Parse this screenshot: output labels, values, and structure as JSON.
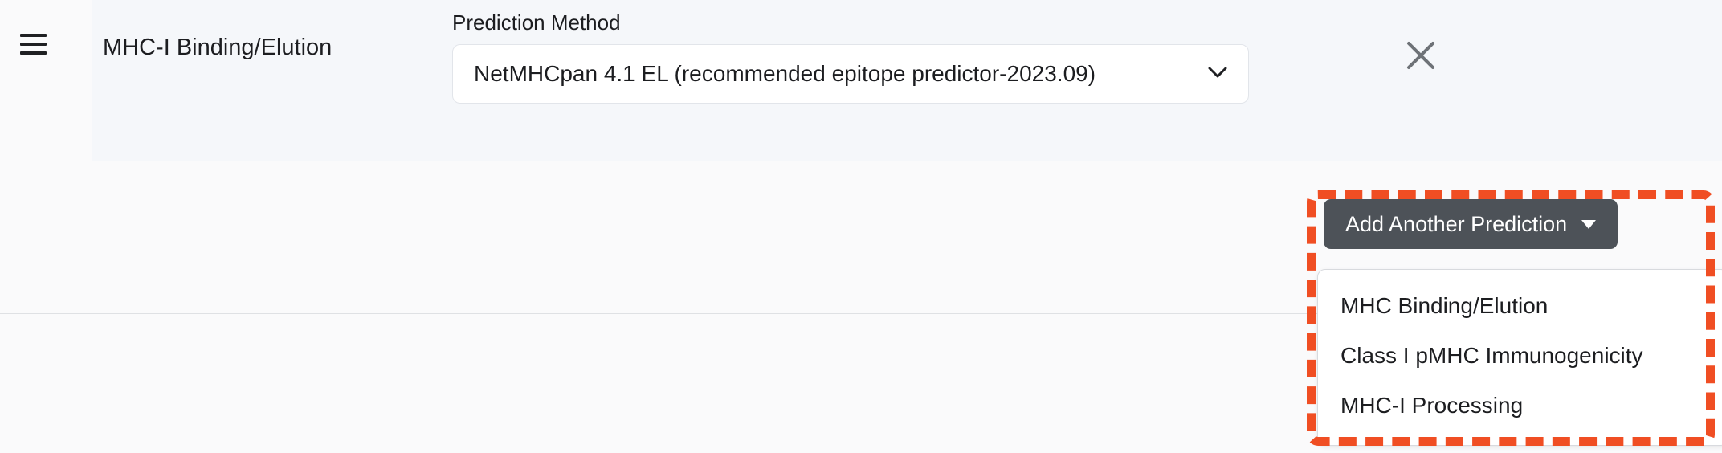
{
  "colors": {
    "page_background": "#FAFAFB",
    "header_panel_background": "#F5F7FA",
    "button_background": "#4D5258",
    "annotation_outline": "#F04E23",
    "text_primary": "#1C1D20",
    "close_icon": "#6E7277"
  },
  "header": {
    "menu_icon": "hamburger-icon",
    "title": "MHC-I Binding/Elution",
    "close_icon": "close-icon",
    "prediction_method": {
      "label": "Prediction Method",
      "selected_value": "NetMHCpan 4.1 EL (recommended epitope predictor-2023.09)",
      "chevron_icon": "chevron-down-icon"
    }
  },
  "add_prediction": {
    "button_label": "Add Another Prediction",
    "caret_icon": "caret-down-icon",
    "menu_open": true,
    "menu_items": [
      {
        "label": "MHC Binding/Elution"
      },
      {
        "label": "Class I pMHC Immunogenicity"
      },
      {
        "label": "MHC-I Processing"
      }
    ]
  },
  "annotation": {
    "style": "dashed-rectangle",
    "color": "#F04E23"
  }
}
